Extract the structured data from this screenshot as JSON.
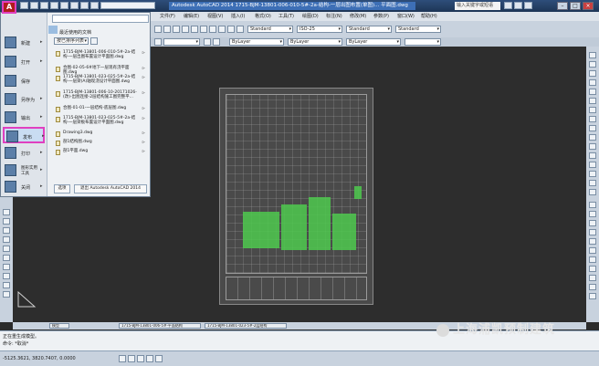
{
  "titlebar": {
    "app_logo": "A",
    "title": "Autodesk AutoCAD 2014  1715-BJM-13801-006-010-5#-2a-结构-一层出图布置(单图)... 平面图.dwg",
    "search_placeholder": "输入关键字或短语"
  },
  "menubar": {
    "items": [
      "文件(F)",
      "编辑(E)",
      "视图(V)",
      "插入(I)",
      "格式(O)",
      "工具(T)",
      "绘图(D)",
      "标注(N)",
      "修改(M)",
      "参数(P)",
      "窗口(W)",
      "帮助(H)"
    ]
  },
  "toolbar": {
    "text_style": "Standard",
    "dim_style": "ISO-25",
    "table_style": "Standard",
    "multileader_style": "Standard",
    "layer": "ByLayer",
    "linetype": "ByLayer",
    "lineweight": "ByLayer"
  },
  "appmenu": {
    "commands": [
      {
        "label": "新建",
        "icon": "new-file-icon"
      },
      {
        "label": "打开",
        "icon": "open-folder-icon"
      },
      {
        "label": "保存",
        "icon": "save-icon"
      },
      {
        "label": "另存为",
        "icon": "save-as-icon"
      },
      {
        "label": "输出",
        "icon": "export-icon"
      },
      {
        "label": "发布",
        "icon": "publish-icon"
      },
      {
        "label": "打印",
        "icon": "print-icon"
      },
      {
        "label": "图形实用工具",
        "icon": "drawing-utilities-icon"
      },
      {
        "label": "关闭",
        "icon": "close-drawing-icon"
      }
    ],
    "recent_title": "最近使用的文档",
    "sort_label": "按已排序列表",
    "documents": [
      "1715-BJM-13801-006-010-5#-2a-结构-一层出图布置设计平面图.dwg",
      "合图-02-05-6#地下一层现有浇平面图.dwg",
      "1715-BJM-13801-023-025-5#-2a-结构-一层梁(A)轴现浇设计平面图.dwg",
      "1715-BJM-13801-006-10-20171026-(改)-出图连接-2层结构施工图完整平...",
      "合图-01-01-一层结构-底层图.dwg",
      "1715-BJM-13801-023-025-5#-2a-结构-一层梁板布置设计平面图.dwg",
      "Drawing3.dwg",
      "剖1结构图.dwg",
      "剖1平面.dwg"
    ],
    "options_label": "选项",
    "exit_label": "退出 Autodesk AutoCAD 2014"
  },
  "tabs": [
    "模型",
    "1715-BJM-13801-006-5#-平面结构",
    "1715-BJM-13801-023-5#-2层结构"
  ],
  "cmdline": {
    "line1": "正在重生成模型。",
    "line2": "命令: *取消*"
  },
  "statusbar": {
    "coords": "-5125.3621, 3820.7407, 0.0000"
  },
  "watermark": "上海浦凯预制建筑"
}
